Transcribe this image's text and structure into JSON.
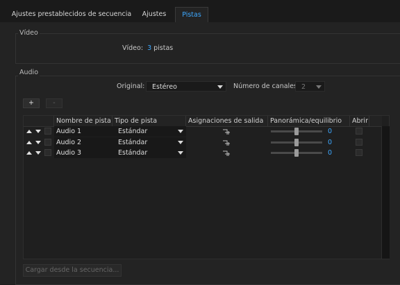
{
  "tabs": [
    {
      "label": "Ajustes prestablecidos de secuencia"
    },
    {
      "label": "Ajustes"
    },
    {
      "label": "Pistas"
    }
  ],
  "video": {
    "legend": "Vídeo",
    "label": "Vídeo:",
    "count": "3",
    "unit": "pistas"
  },
  "audio": {
    "legend": "Audio",
    "original_label": "Original:",
    "original_value": "Estéreo",
    "channels_label": "Número de canales:",
    "channels_value": "2",
    "add_label": "+",
    "remove_label": "-"
  },
  "table": {
    "columns": [
      "Nombre de pista",
      "Tipo de pista",
      "Asignaciones de salida",
      "Panorámica/equilibrio",
      "Abrir"
    ],
    "rows": [
      {
        "name": "Audio 1",
        "type": "Estándar",
        "pan": "0",
        "pan_level": 0.5
      },
      {
        "name": "Audio 2",
        "type": "Estándar",
        "pan": "0",
        "pan_level": 0.5
      },
      {
        "name": "Audio 3",
        "type": "Estándar",
        "pan": "0",
        "pan_level": 0.5
      }
    ]
  },
  "load_button": "Cargar desde la secuencia...",
  "colors": {
    "accent": "#3da8ff",
    "background": "#232323"
  },
  "icons": [
    "move-up-icon",
    "move-down-icon",
    "output-routing-icon",
    "dropdown-caret-icon"
  ]
}
